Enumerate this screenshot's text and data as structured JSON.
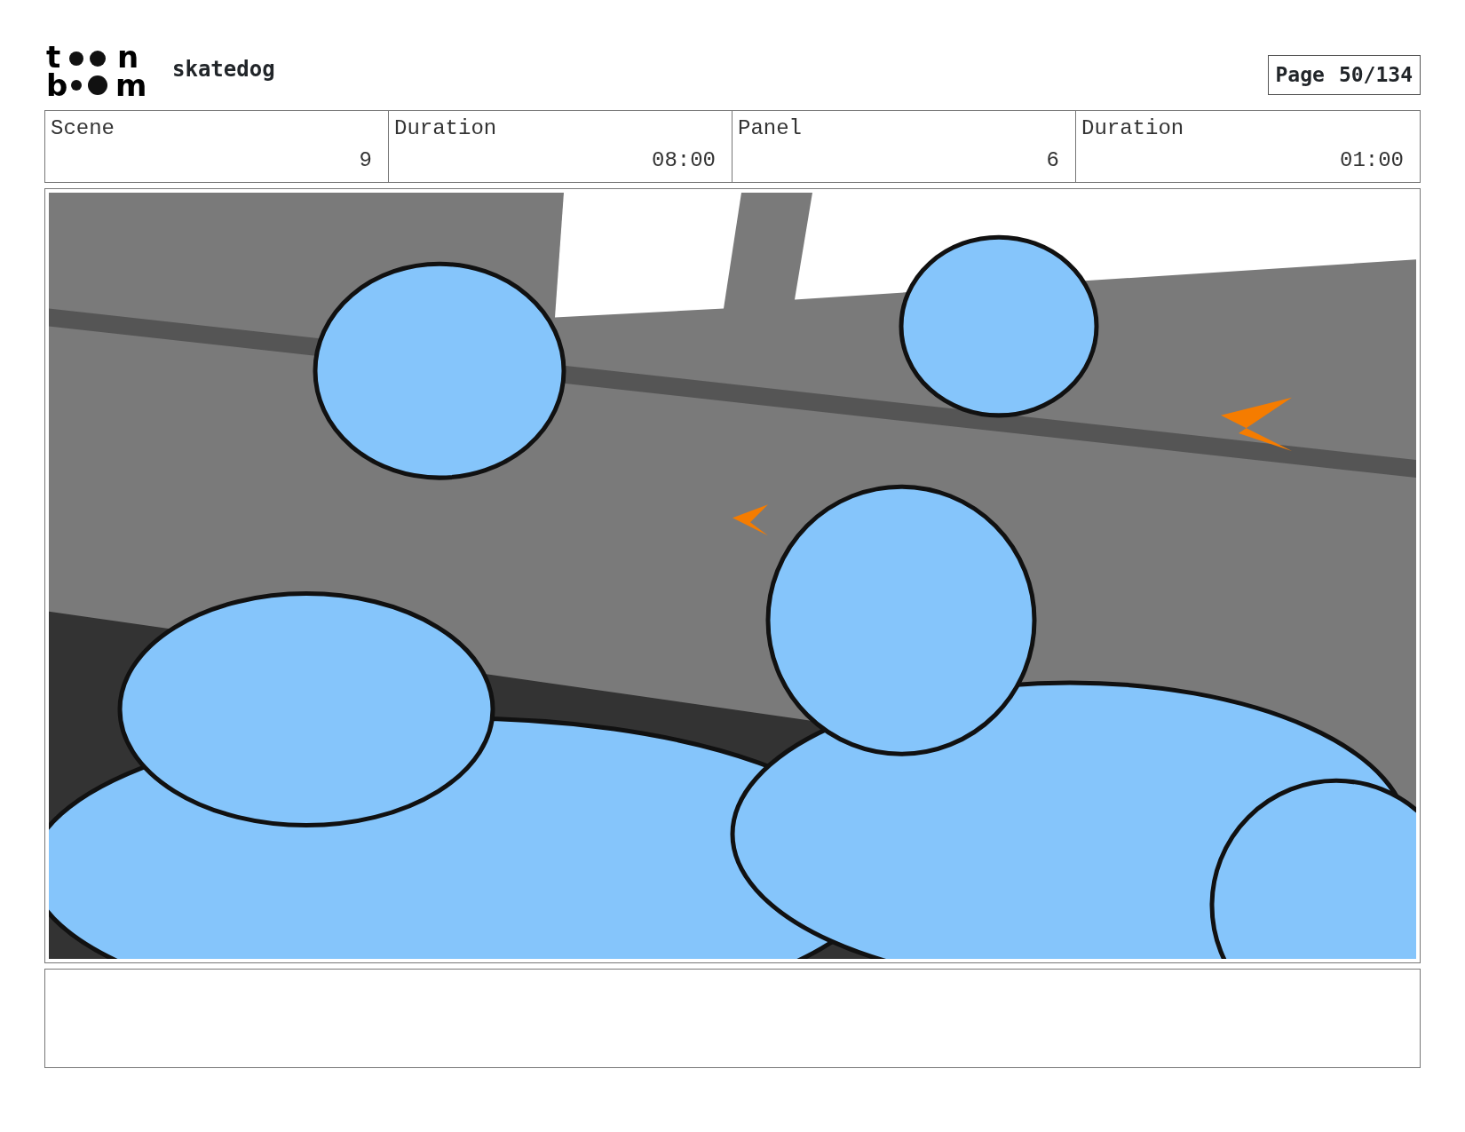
{
  "logo": {
    "letters": [
      "t",
      "n",
      "b",
      "m"
    ]
  },
  "project": "skatedog",
  "page": {
    "label": "Page",
    "value": "50/134"
  },
  "fields": [
    {
      "label": "Scene",
      "value": "9"
    },
    {
      "label": "Duration",
      "value": "08:00"
    },
    {
      "label": "Panel",
      "value": "6"
    },
    {
      "label": "Duration",
      "value": "01:00"
    }
  ]
}
